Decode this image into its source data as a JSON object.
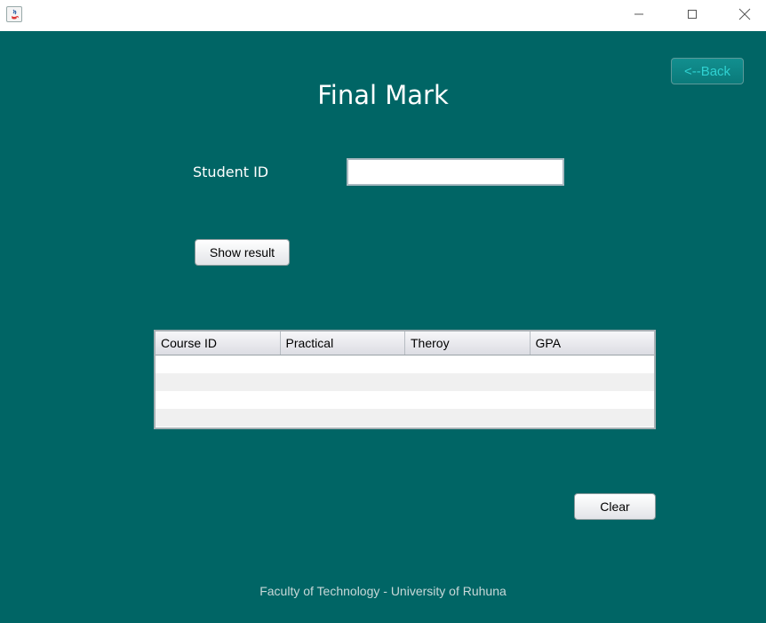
{
  "window": {
    "controls": [
      "minimize-icon",
      "maximize-icon",
      "close-icon"
    ]
  },
  "header": {
    "back_label": "<--Back",
    "title": "Final Mark"
  },
  "form": {
    "student_id_label": "Student ID",
    "student_id_value": "",
    "show_result_label": "Show result"
  },
  "table": {
    "columns": [
      "Course ID",
      "Practical",
      "Theroy",
      "GPA"
    ],
    "rows": []
  },
  "actions": {
    "clear_label": "Clear"
  },
  "footer": {
    "text": "Faculty of Technology - University of Ruhuna"
  },
  "colors": {
    "background": "#006565",
    "accent_button": "#0a8a8a",
    "back_text": "#2fd1d1"
  }
}
